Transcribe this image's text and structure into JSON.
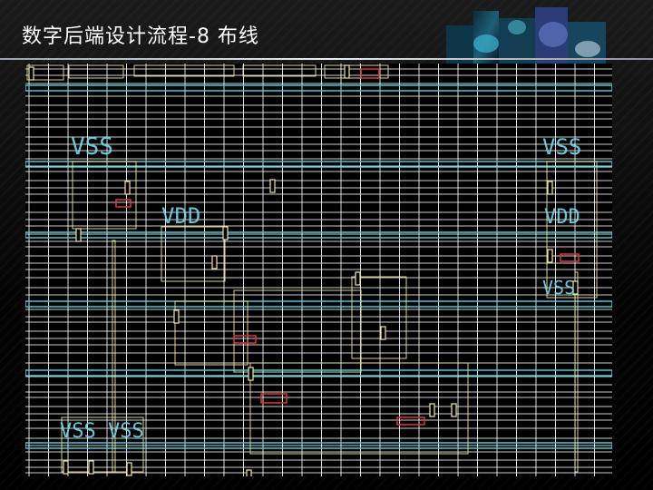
{
  "slide": {
    "title": "数字后端设计流程-8 布线"
  },
  "colors": {
    "grid_line": "#ffffff",
    "power_rail": "#4fd6e6",
    "cell_outline": "#f2e6a0",
    "wire_red": "#e0323a",
    "text_label": "#6fdcf0",
    "title_rule": "#d8dde3"
  },
  "layout_labels": [
    {
      "text": "VSS"
    },
    {
      "text": "VSS"
    },
    {
      "text": "VDD"
    },
    {
      "text": "VDD"
    },
    {
      "text": "VSS"
    },
    {
      "text": "VSS VSS"
    }
  ]
}
